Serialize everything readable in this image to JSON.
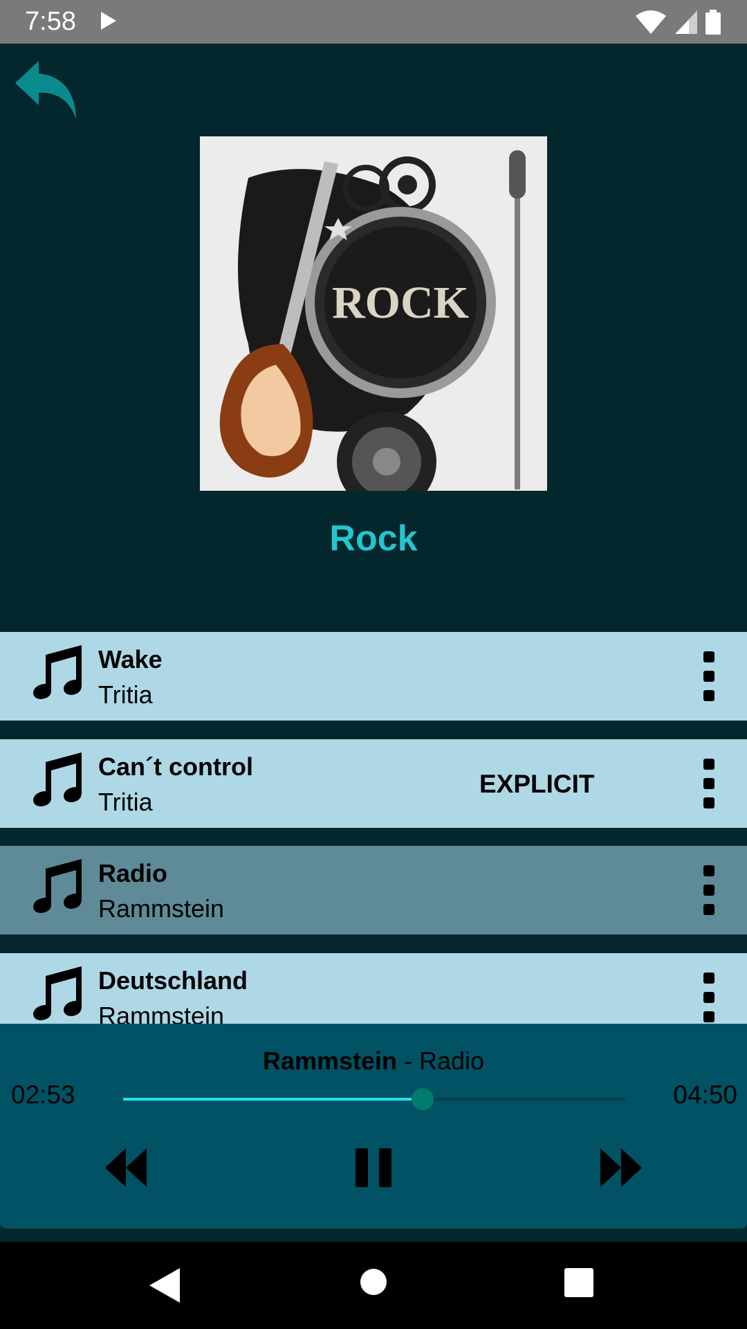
{
  "status_bar": {
    "time": "7:58",
    "icons": [
      "play-icon",
      "wifi-icon",
      "signal-icon",
      "battery-icon"
    ]
  },
  "header": {
    "back_icon": "back-arrow-icon",
    "accent_color": "#0b8a8e"
  },
  "album": {
    "title": "Rock",
    "cover_text": "ROCK",
    "title_color": "#22c6cf"
  },
  "tracks": [
    {
      "title": "Wake",
      "artist": "Tritia",
      "explicit": "",
      "active": false
    },
    {
      "title": "Can´t control",
      "artist": "Tritia",
      "explicit": "EXPLICIT",
      "active": false
    },
    {
      "title": "Radio",
      "artist": "Rammstein",
      "explicit": "",
      "active": true
    },
    {
      "title": "Deutschland",
      "artist": "Rammstein",
      "explicit": "",
      "active": false
    }
  ],
  "player": {
    "artist": "Rammstein",
    "separator": " - ",
    "title": "Radio",
    "current_time": "02:53",
    "total_time": "04:50",
    "progress": 0.597,
    "controls": [
      "rewind-icon",
      "pause-icon",
      "fast-forward-icon"
    ]
  },
  "nav_bar": {
    "buttons": [
      "back-triangle-icon",
      "home-circle-icon",
      "recents-square-icon"
    ]
  },
  "colors": {
    "background": "#03272d",
    "row": "#aed8e6",
    "row_active": "#5f8b98",
    "player": "#005264",
    "progress": "#22e4ef",
    "thumb": "#007b6e"
  }
}
